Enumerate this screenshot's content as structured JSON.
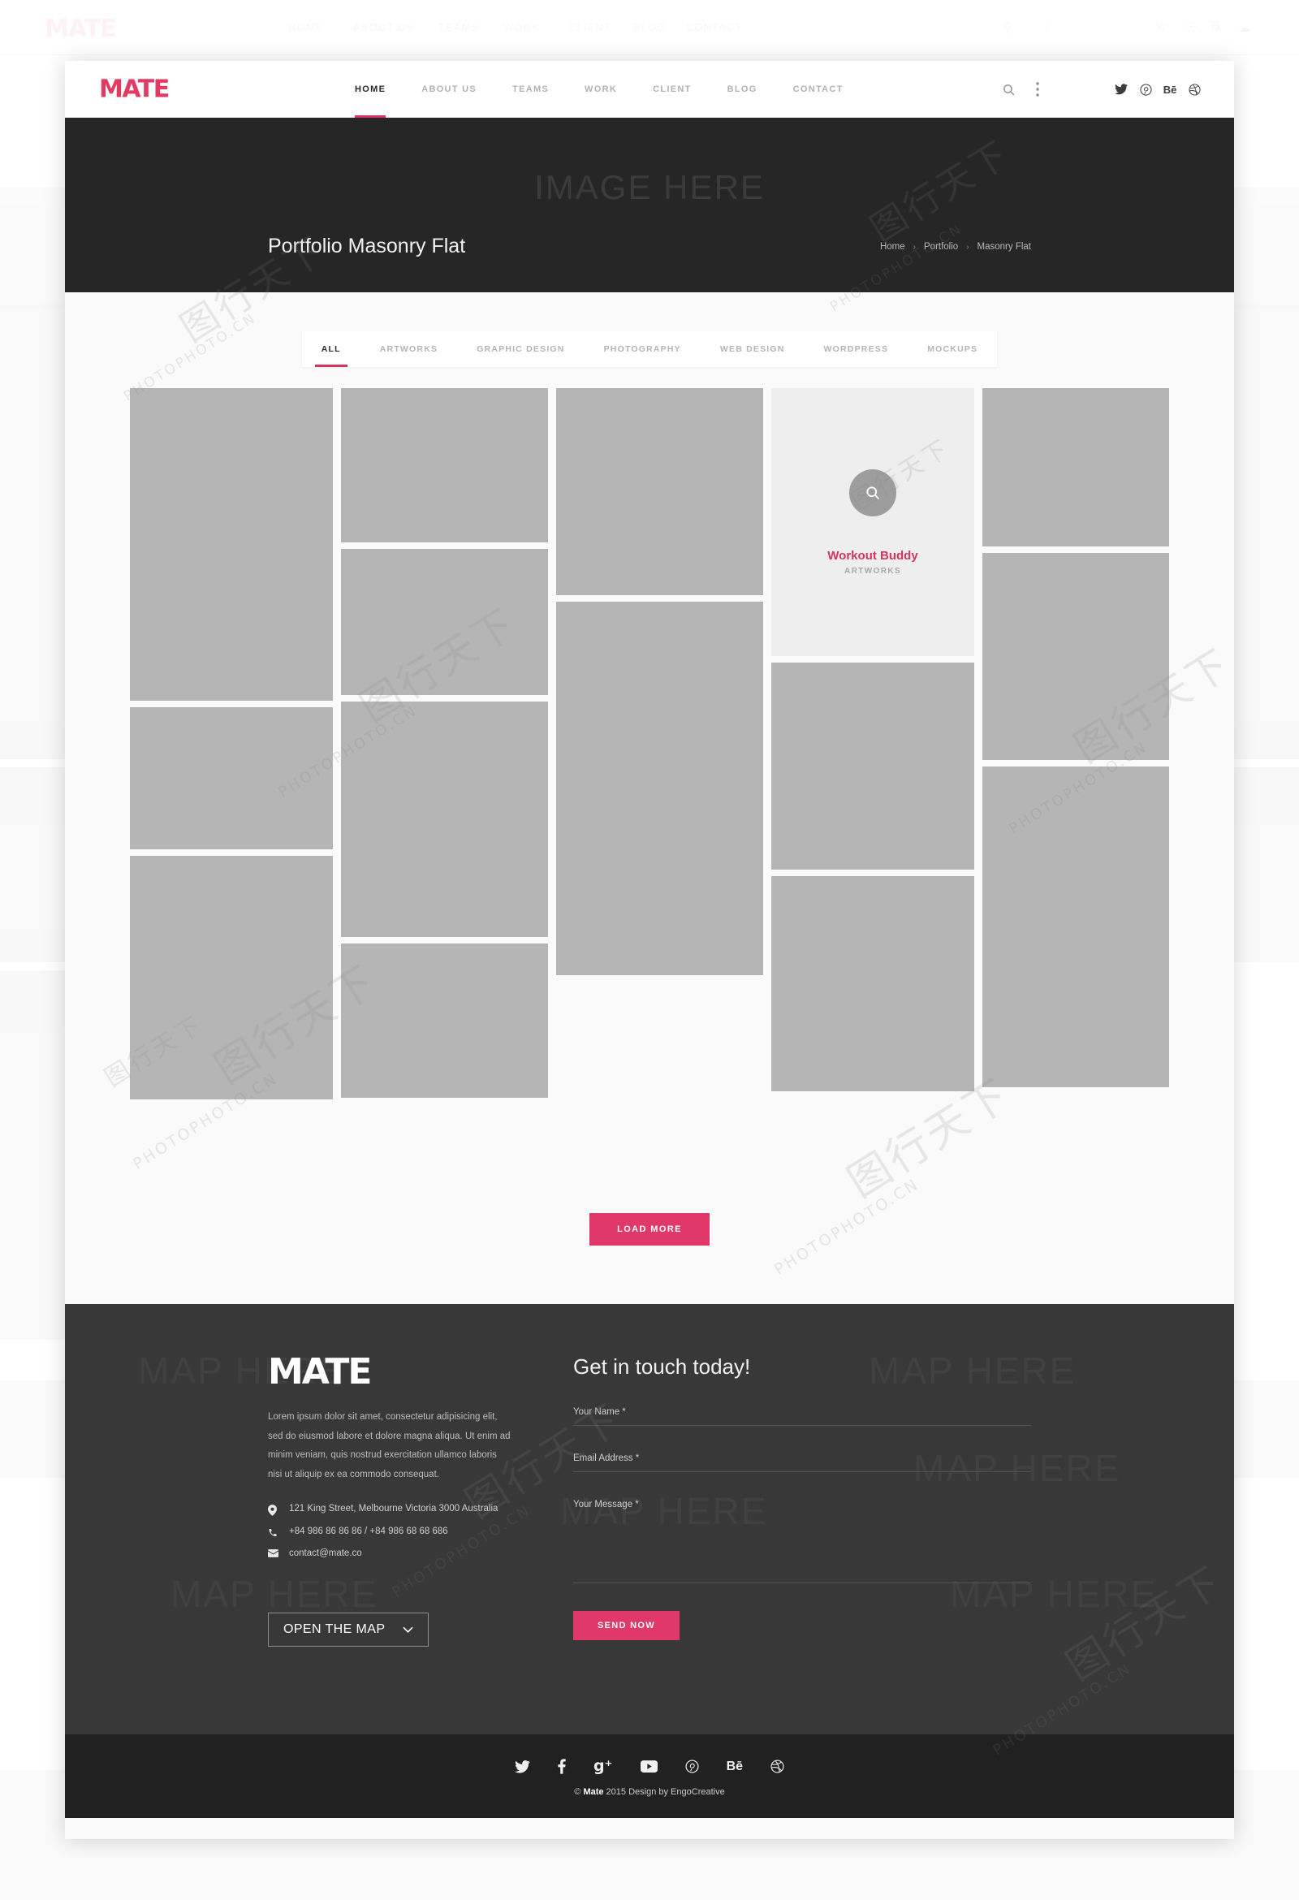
{
  "brand": {
    "name": "MATE",
    "accent": "#d8345f",
    "accent_button": "#e0386a"
  },
  "header": {
    "logo": "MATE",
    "menu": [
      {
        "label": "HOME",
        "active": true
      },
      {
        "label": "ABOUT US",
        "active": false
      },
      {
        "label": "TEAMS",
        "active": false
      },
      {
        "label": "WORK",
        "active": false
      },
      {
        "label": "CLIENT",
        "active": false
      },
      {
        "label": "BLOG",
        "active": false
      },
      {
        "label": "CONTACT",
        "active": false
      }
    ],
    "tools": [
      "search-icon",
      "more-vertical-icon"
    ],
    "social": [
      "twitter-icon",
      "pinterest-icon",
      "behance-icon",
      "dribbble-icon"
    ]
  },
  "hero": {
    "ghost_label": "IMAGE HERE",
    "title": "Portfolio Masonry Flat",
    "breadcrumb": [
      {
        "label": "Home"
      },
      {
        "label": "Portfolio"
      },
      {
        "label": "Masonry Flat"
      }
    ],
    "breadcrumb_separator": "›"
  },
  "portfolio": {
    "filters": [
      {
        "label": "ALL",
        "active": true
      },
      {
        "label": "ARTWORKS",
        "active": false
      },
      {
        "label": "GRAPHIC DESIGN",
        "active": false
      },
      {
        "label": "PHOTOGRAPHY",
        "active": false
      },
      {
        "label": "WEB DESIGN",
        "active": false
      },
      {
        "label": "WORDPRESS",
        "active": false
      },
      {
        "label": "MOCKUPS",
        "active": false
      }
    ],
    "hovered_item": {
      "title": "Workout Buddy",
      "category": "ARTWORKS",
      "icon": "magnifier-icon"
    },
    "load_more_label": "LOAD MORE"
  },
  "footer": {
    "logo": "MATE",
    "description": "Lorem ipsum dolor sit amet, consectetur adipisicing elit, sed do eiusmod labore et dolore magna aliqua. Ut enim ad minim veniam, quis nostrud exercitation ullamco laboris nisi ut aliquip ex ea commodo consequat.",
    "contact": [
      {
        "icon": "location-pin-icon",
        "text": "121 King Street, Melbourne Victoria 3000 Australia"
      },
      {
        "icon": "phone-icon",
        "text": "+84 986 86 86 86 / +84 986 68 68 686"
      },
      {
        "icon": "envelope-icon",
        "text": "contact@mate.co"
      }
    ],
    "map_button": "OPEN THE MAP",
    "map_ghost_label": "MAP HERE",
    "form": {
      "title": "Get in touch today!",
      "fields": [
        {
          "label": "Your Name *",
          "value": ""
        },
        {
          "label": "Email Address *",
          "value": ""
        },
        {
          "label": "Your Message *",
          "value": ""
        }
      ],
      "submit_label": "SEND NOW"
    }
  },
  "bottom_bar": {
    "social": [
      "twitter-icon",
      "facebook-icon",
      "google-plus-icon",
      "youtube-icon",
      "pinterest-icon",
      "behance-icon",
      "dribbble-icon"
    ],
    "copyright_prefix": "© ",
    "copyright_brand": "Mate",
    "copyright_rest": " 2015 Design by EngoCreative"
  },
  "watermark": {
    "latin": "PHOTOPHOTO.CN",
    "cn": "图行天下"
  }
}
